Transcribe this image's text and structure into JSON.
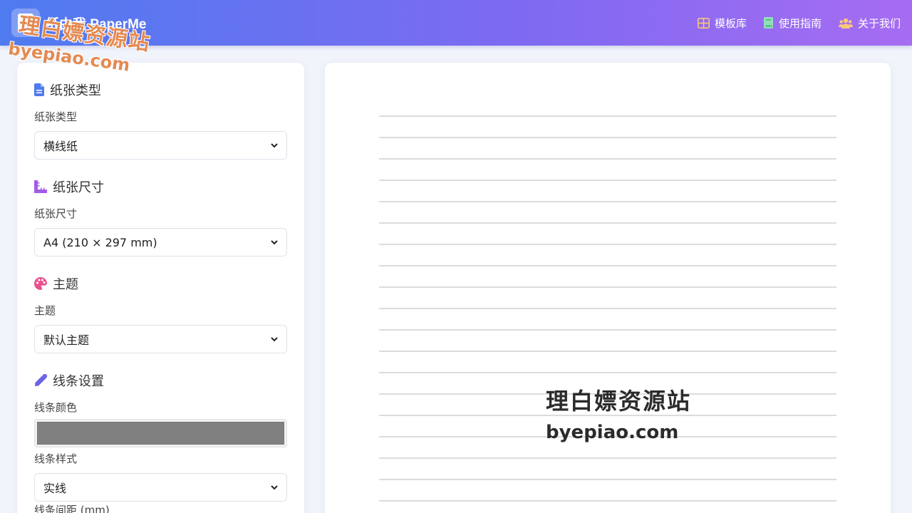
{
  "header": {
    "brand_title": "纸由我 PaperMe",
    "nav": [
      {
        "label": "模板库",
        "icon": "grid-icon",
        "color": "#f8c77a"
      },
      {
        "label": "使用指南",
        "icon": "book-icon",
        "color": "#8fe0b8"
      },
      {
        "label": "关于我们",
        "icon": "users-icon",
        "color": "#f8c77a"
      }
    ]
  },
  "watermark": {
    "cn": "理白嫖资源站",
    "en": "byepiao.com"
  },
  "sidebar": {
    "paper_type": {
      "title": "纸张类型",
      "label": "纸张类型",
      "value": "横线纸",
      "icon": "document-icon",
      "color": "#4f7bf0"
    },
    "paper_size": {
      "title": "纸张尺寸",
      "label": "纸张尺寸",
      "value": "A4 (210 × 297 mm)",
      "icon": "ruler-icon",
      "color": "#a45be8"
    },
    "theme": {
      "title": "主题",
      "label": "主题",
      "value": "默认主题",
      "icon": "palette-icon",
      "color": "#ec4f8d"
    },
    "lines": {
      "title": "线条设置",
      "icon": "pencil-icon",
      "color": "#6b63e6",
      "color_label": "线条颜色",
      "color_value": "#808080",
      "style_label": "线条样式",
      "style_value": "实线",
      "spacing_label": "线条间距 (mm)"
    }
  },
  "preview": {
    "line_color": "#dcdcdc"
  }
}
